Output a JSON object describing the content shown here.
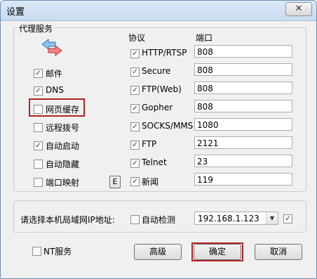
{
  "window": {
    "title": "设置",
    "close_glyph": "✕"
  },
  "proxy": {
    "group_title": "代理服务",
    "services": [
      {
        "label": "邮件",
        "checked": true
      },
      {
        "label": "DNS",
        "checked": true
      },
      {
        "label": "网页缓存",
        "checked": false
      },
      {
        "label": "远程拨号",
        "checked": false
      },
      {
        "label": "自动启动",
        "checked": true
      },
      {
        "label": "自动隐藏",
        "checked": false
      },
      {
        "label": "端口映射",
        "checked": false
      }
    ],
    "port_map_edit_label": "E",
    "protocol_header": "协议",
    "port_header": "端口",
    "protocols": [
      {
        "label": "HTTP/RTSP",
        "checked": true,
        "port": "808"
      },
      {
        "label": "Secure",
        "checked": true,
        "port": "808"
      },
      {
        "label": "FTP(Web)",
        "checked": true,
        "port": "808"
      },
      {
        "label": "Gopher",
        "checked": true,
        "port": "808"
      },
      {
        "label": "SOCKS/MMS",
        "checked": true,
        "port": "1080"
      },
      {
        "label": "FTP",
        "checked": true,
        "port": "2121"
      },
      {
        "label": "Telnet",
        "checked": true,
        "port": "23"
      },
      {
        "label": "新闻",
        "checked": true,
        "port": "119"
      }
    ]
  },
  "lan": {
    "prompt": "请选择本机局域网IP地址:",
    "auto_detect_label": "自动检测",
    "auto_detect_checked": false,
    "ip_value": "192.168.1.123",
    "extra_checked": true
  },
  "footer": {
    "nt_service_label": "NT服务",
    "nt_service_checked": false,
    "advanced_label": "高级",
    "ok_label": "确定",
    "cancel_label": "取消"
  },
  "colors": {
    "highlight": "#b32323",
    "check": "#1c3c7d"
  }
}
